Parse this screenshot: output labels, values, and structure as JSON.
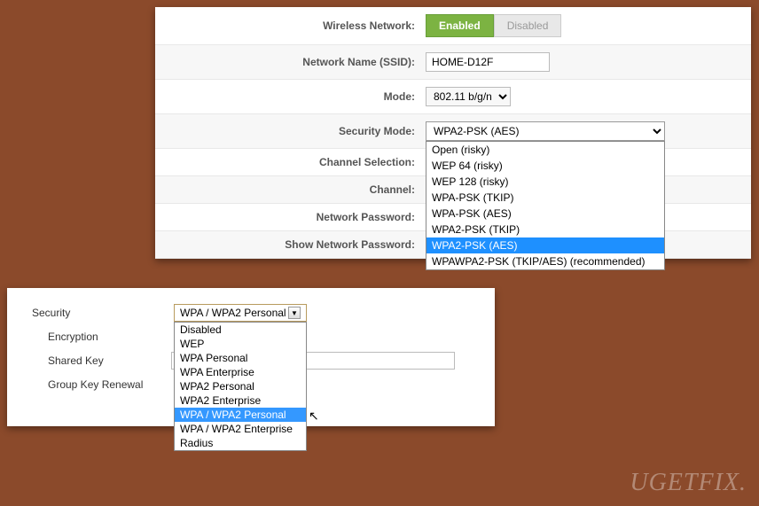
{
  "panel1": {
    "wireless_label": "Wireless Network:",
    "enabled_btn": "Enabled",
    "disabled_btn": "Disabled",
    "ssid_label": "Network Name (SSID):",
    "ssid_value": "HOME-D12F",
    "mode_label": "Mode:",
    "mode_value": "802.11 b/g/n",
    "security_label": "Security Mode:",
    "security_value": "WPA2-PSK (AES)",
    "security_options": [
      "Open (risky)",
      "WEP 64 (risky)",
      "WEP 128 (risky)",
      "WPA-PSK (TKIP)",
      "WPA-PSK (AES)",
      "WPA2-PSK (TKIP)",
      "WPA2-PSK (AES)",
      "WPAWPA2-PSK (TKIP/AES) (recommended)"
    ],
    "security_selected_index": 6,
    "channel_sel_label": "Channel Selection:",
    "channel_label": "Channel:",
    "password_label": "Network Password:",
    "show_password_label": "Show Network Password:",
    "show_password_checked": true
  },
  "panel2": {
    "security_label": "Security",
    "security_value": "WPA / WPA2 Personal",
    "encryption_label": "Encryption",
    "shared_key_label": "Shared Key",
    "group_key_label": "Group Key Renewal",
    "options": [
      "Disabled",
      "WEP",
      "WPA Personal",
      "WPA Enterprise",
      "WPA2 Personal",
      "WPA2 Enterprise",
      "WPA / WPA2 Personal",
      "WPA / WPA2 Enterprise",
      "Radius"
    ],
    "selected_index": 6
  },
  "watermark": "UGETFIX."
}
